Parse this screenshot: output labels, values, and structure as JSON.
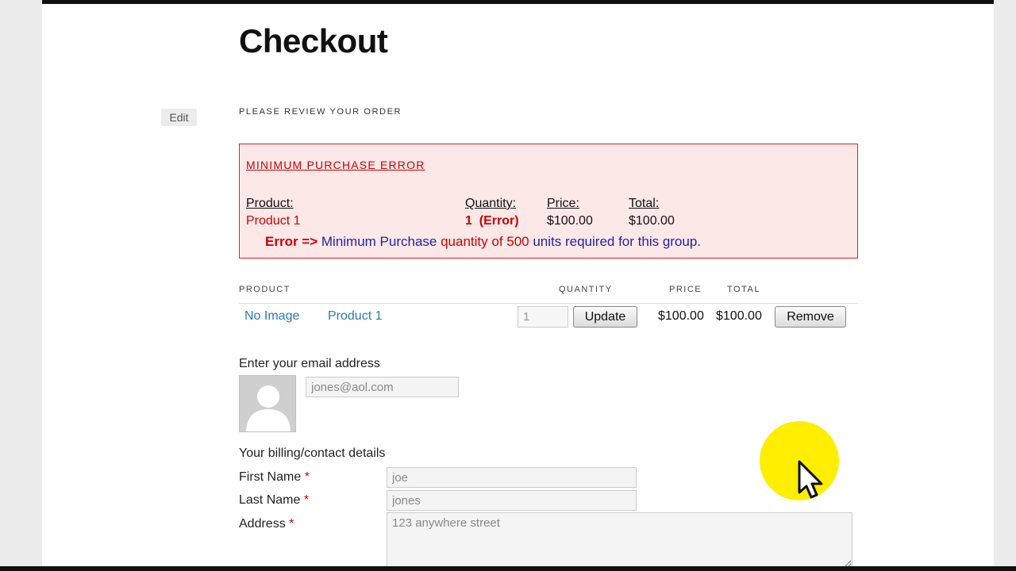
{
  "page": {
    "title": "Checkout",
    "edit_label": "Edit",
    "review_heading": "PLEASE REVIEW YOUR ORDER"
  },
  "error_box": {
    "title": "MINIMUM PURCHASE ERROR",
    "headers": {
      "product": "Product:",
      "quantity": "Quantity:",
      "price": "Price:",
      "total": "Total:"
    },
    "row": {
      "product": "Product 1",
      "quantity": "1  (Error)",
      "price": "$100.00",
      "total": "$100.00"
    },
    "message": {
      "label": "Error =>",
      "part1": " Minimum Purchase ",
      "part2": "quantity of 500",
      "part3": " units required for this group."
    }
  },
  "cart": {
    "headers": {
      "product": "PRODUCT",
      "quantity": "QUANTITY",
      "price": "PRICE",
      "total": "TOTAL"
    },
    "rows": [
      {
        "image": "No Image",
        "product": "Product 1",
        "quantity": "1",
        "update_label": "Update",
        "price": "$100.00",
        "total": "$100.00",
        "remove_label": "Remove"
      }
    ]
  },
  "email": {
    "label": "Enter your email address",
    "value": "jones@aol.com"
  },
  "billing": {
    "heading": "Your billing/contact details",
    "required_mark": "*",
    "first_name_label": "First Name",
    "first_name_value": "joe",
    "last_name_label": "Last Name",
    "last_name_value": "jones",
    "address_label": "Address",
    "address_value": "123 anywhere street"
  },
  "colors": {
    "error_red": "#cc0000",
    "link_blue": "#2a7ab8",
    "error_bg": "#fde8e8",
    "highlight_yellow": "#ffee00"
  },
  "icons": {
    "cursor": "mouse-pointer-icon",
    "avatar": "user-silhouette-icon"
  }
}
